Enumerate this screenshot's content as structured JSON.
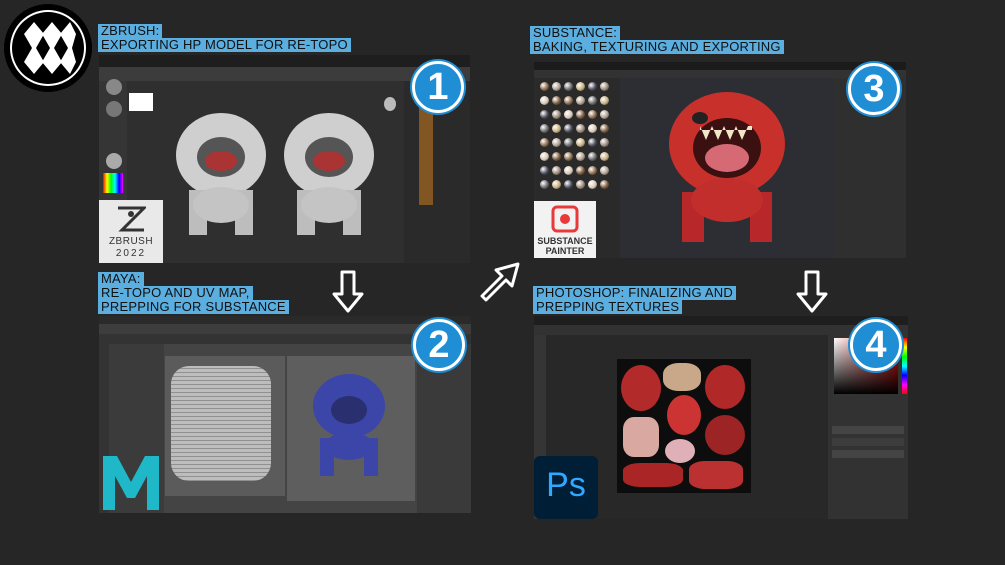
{
  "sections": [
    {
      "number": "1",
      "lines": [
        "ZBRUSH:",
        "EXPORTING HP MODEL FOR RE-TOPO"
      ]
    },
    {
      "number": "2",
      "lines": [
        "MAYA:",
        "RE-TOPO AND UV MAP,",
        "PREPPING FOR SUBSTANCE"
      ]
    },
    {
      "number": "3",
      "lines": [
        "SUBSTANCE:",
        "BAKING, TEXTURING AND EXPORTING"
      ]
    },
    {
      "number": "4",
      "lines": [
        "PHOTOSHOP: FINALIZING AND",
        "PREPPING TEXTURES"
      ]
    }
  ],
  "logos": {
    "zbrush": {
      "name": "ZBRUSH",
      "year": "2022"
    },
    "substance": {
      "line1": "SUBSTANCE",
      "line2": "PAINTER"
    },
    "photoshop": {
      "text": "Ps"
    }
  },
  "colors": {
    "background": "#262626",
    "caption": "#5aaee0",
    "badge": "#1f8ed4",
    "maya_teal": "#1fb8c8",
    "substance_red": "#e83a3a",
    "photoshop_bg": "#001e36",
    "photoshop_text": "#31a8ff"
  }
}
